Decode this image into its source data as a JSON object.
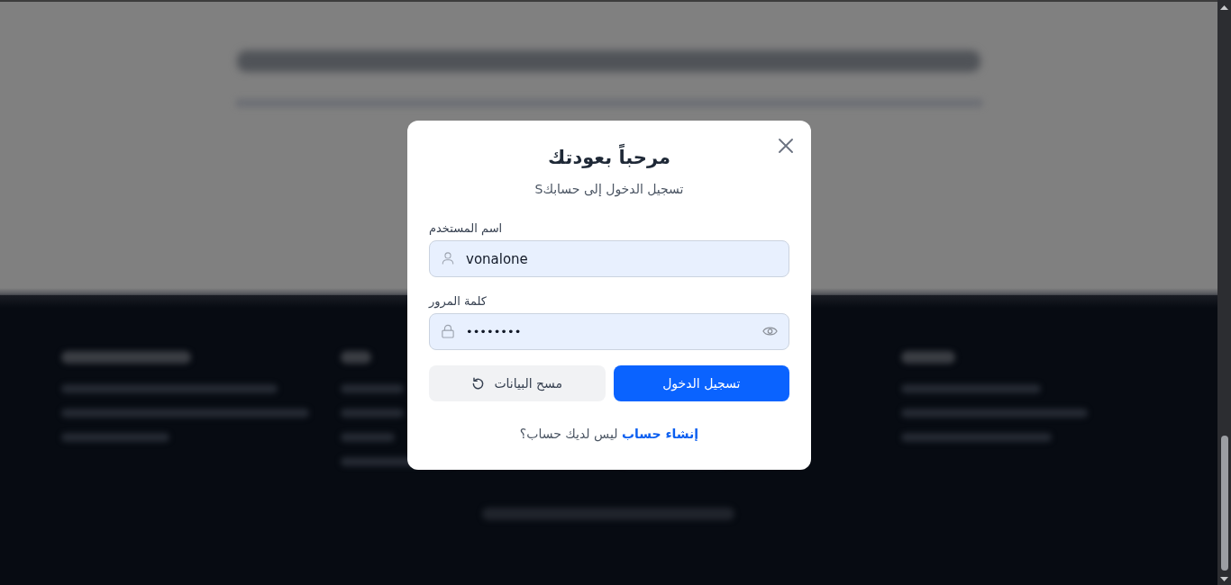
{
  "modal": {
    "title": "مرحباً بعودتك",
    "subtitle": "تسجيل الدخول إلى حسابكS",
    "fields": [
      {
        "kind": "text",
        "label": "اسم المستخدم",
        "value": "vonalone"
      },
      {
        "kind": "password",
        "label": "كلمة المرور",
        "value": "••••••••"
      }
    ],
    "buttons": [
      {
        "kind": "submit",
        "label": "تسجيل الدخول"
      },
      {
        "kind": "reset",
        "label": "مسح البيانات"
      }
    ],
    "signup": {
      "link": "إنشاء حساب",
      "prompt": "ليس لديك حساب؟"
    }
  }
}
